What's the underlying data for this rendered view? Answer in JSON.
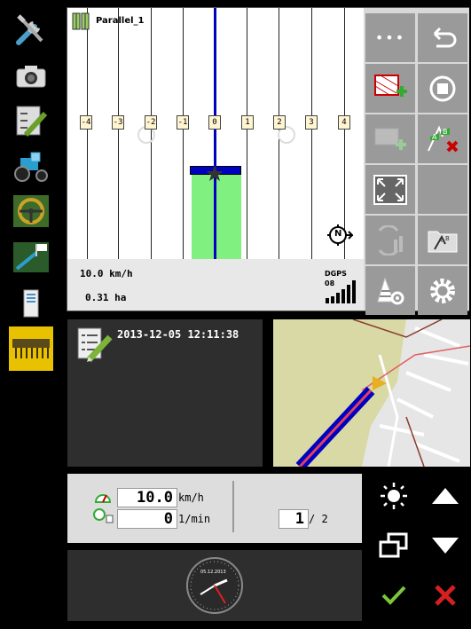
{
  "guidance": {
    "track_name": "Parallel_1",
    "swath_labels": [
      "-4",
      "-3",
      "-2",
      "-1",
      "0",
      "1",
      "2",
      "3",
      "4"
    ],
    "speed": "10.0 km/h",
    "area": "0.31 ha",
    "gps_mode": "DGPS",
    "gps_satellites": "08",
    "compass": "N"
  },
  "toolbar": {
    "more_label": "•••"
  },
  "documentation": {
    "timestamp": "2013-12-05 12:11:38"
  },
  "readouts": {
    "speed_value": "10.0",
    "speed_unit": "km/h",
    "rpm_value": "0",
    "rpm_unit": "1/min",
    "page_current": "1",
    "page_total": "/ 2"
  },
  "clock": {
    "date": "05.12.2013"
  },
  "colors": {
    "accent_yellow": "#e8c200",
    "confirm_green": "#7cc63a",
    "cancel_red": "#d42020",
    "worked_area": "#80f080",
    "guidance_blue": "#0000c0"
  }
}
